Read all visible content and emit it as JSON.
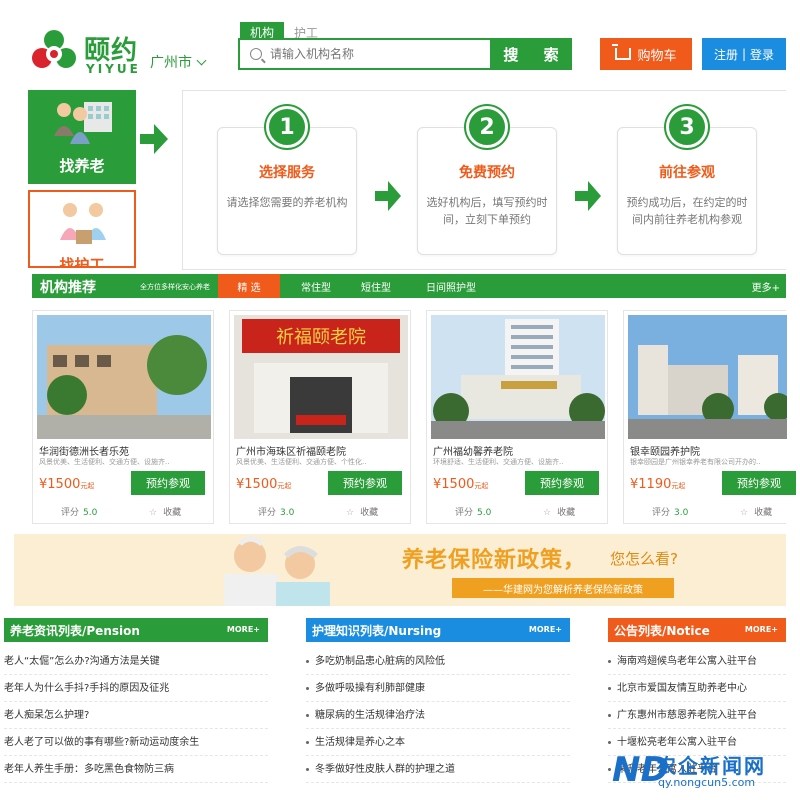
{
  "header": {
    "brand_cn": "颐约",
    "brand_en": "YIYUE",
    "city": "广州市",
    "search_tabs": [
      "机构",
      "护工"
    ],
    "search_placeholder": "请输入机构名称",
    "search_button": "搜 索",
    "cart": "购物车",
    "register": "注册",
    "divider": "|",
    "login": "登录"
  },
  "side_tiles": {
    "find_elderly": "找养老",
    "find_nurse": "找护工"
  },
  "steps": [
    {
      "num": "1",
      "title": "选择服务",
      "desc": "请选择您需要的养老机构"
    },
    {
      "num": "2",
      "title": "免费预约",
      "desc": "选好机构后，填写预约时间，立刻下单预约"
    },
    {
      "num": "3",
      "title": "前往参观",
      "desc": "预约成功后，在约定的时间内前往养老机构参观"
    }
  ],
  "recommend": {
    "title": "机构推荐",
    "subtitle": "全方位多样化安心养老",
    "tabs": [
      "精 选",
      "常住型",
      "短住型",
      "日间照护型"
    ],
    "more": "更多+"
  },
  "cards": [
    {
      "name": "华润街德洲长者乐苑",
      "features": "风景优美、生活便利、交通方便、设施齐...",
      "price": "¥1500",
      "unit": "元起",
      "book": "预约参观",
      "rating_label": "评分",
      "rating": "5.0",
      "fav": "收藏"
    },
    {
      "name": "广州市海珠区祈福颐老院",
      "features": "风景优美、生活便利、交通方便、个性化...",
      "price": "¥1500",
      "unit": "元起",
      "book": "预约参观",
      "rating_label": "评分",
      "rating": "3.0",
      "fav": "收藏"
    },
    {
      "name": "广州福幼馨养老院",
      "features": "环境舒适、生活便利、交通方便、设施齐...",
      "price": "¥1500",
      "unit": "元起",
      "book": "预约参观",
      "rating_label": "评分",
      "rating": "5.0",
      "fav": "收藏"
    },
    {
      "name": "银幸颐园养护院",
      "features": "银幸颐园是广州银幸养老有限公司开办的...",
      "price": "¥1190",
      "unit": "元起",
      "book": "预约参观",
      "rating_label": "评分",
      "rating": "3.0",
      "fav": "收藏"
    }
  ],
  "banner": {
    "title": "养老保险新政策，",
    "question": "您怎么看?",
    "subtitle": "——华建网为您解析养老保险新政策"
  },
  "news": [
    {
      "title": "养老资讯列表/Pension",
      "more": "MORE+",
      "color": "#2a9d3a",
      "items": [
        "老人“太倔”怎么办?沟通方法是关键",
        "老年人为什么手抖?手抖的原因及征兆",
        "老人痴呆怎么护理?",
        "老人老了可以做的事有哪些?新动运动度余生",
        "老年人养生手册：多吃黑色食物防三病"
      ]
    },
    {
      "title": "护理知识列表/Nursing",
      "more": "MORE+",
      "color": "#1a8de0",
      "items": [
        "多吃奶制品患心脏病的风险低",
        "多做呼吸操有利肺部健康",
        "糖尿病的生活规律治疗法",
        "生活规律是养心之本",
        "冬季做好性皮肤人群的护理之道"
      ]
    },
    {
      "title": "公告列表/Notice",
      "more": "MORE+",
      "color": "#f05a1a",
      "items": [
        "海南鸡翅候鸟老年公寓入驻平台",
        "北京市爱国友情互助养老中心",
        "广东惠州市慈恩养老院入驻平台",
        "十堰松亮老年公寓入驻平台",
        "荣升老年公寓入驻平台"
      ]
    }
  ],
  "watermark": {
    "logo": "ND",
    "name": "农企新闻网",
    "url": "qy.nongcun5.com"
  }
}
